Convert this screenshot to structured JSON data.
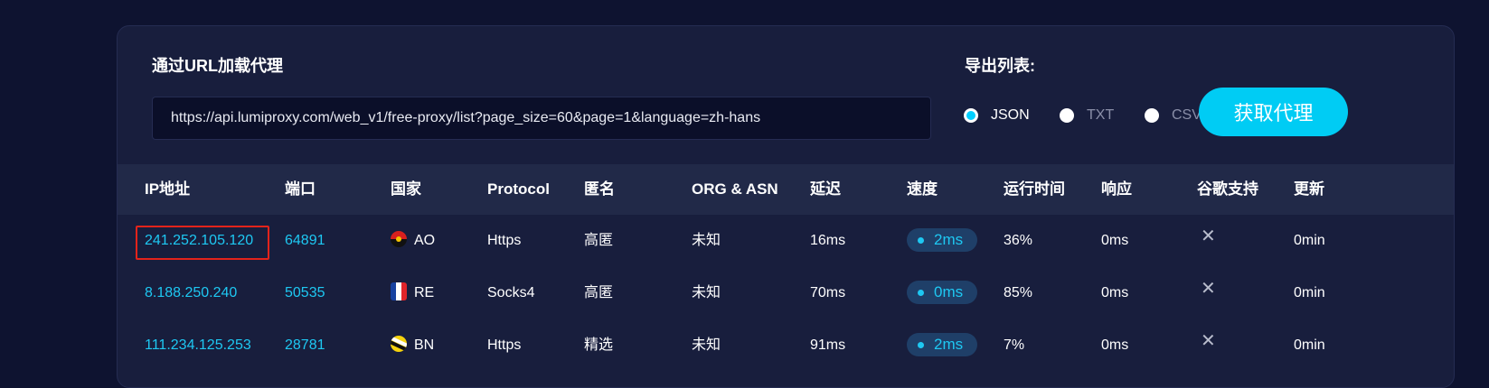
{
  "loader": {
    "title": "通过URL加载代理",
    "url_value": "https://api.lumiproxy.com/web_v1/free-proxy/list?page_size=60&page=1&language=zh-hans"
  },
  "export": {
    "title": "导出列表:",
    "options": [
      {
        "label": "JSON",
        "selected": true
      },
      {
        "label": "TXT",
        "selected": false
      },
      {
        "label": "CSV",
        "selected": false
      }
    ],
    "fetch_button": "获取代理"
  },
  "table": {
    "headers": [
      "IP地址",
      "端口",
      "国家",
      "Protocol",
      "匿名",
      "ORG & ASN",
      "延迟",
      "速度",
      "运行时间",
      "响应",
      "谷歌支持",
      "更新"
    ],
    "rows": [
      {
        "ip": "241.252.105.120",
        "port": "64891",
        "country": "AO",
        "flag": "angola-flag-icon",
        "protocol": "Https",
        "anonymity": "高匿",
        "org": "未知",
        "latency": "16ms",
        "speed": "2ms",
        "uptime": "36%",
        "response": "0ms",
        "google": "close-icon",
        "updated": "0min"
      },
      {
        "ip": "8.188.250.240",
        "port": "50535",
        "country": "RE",
        "flag": "france-flag-icon",
        "protocol": "Socks4",
        "anonymity": "高匿",
        "org": "未知",
        "latency": "70ms",
        "speed": "0ms",
        "uptime": "85%",
        "response": "0ms",
        "google": "close-icon",
        "updated": "0min"
      },
      {
        "ip": "111.234.125.253",
        "port": "28781",
        "country": "BN",
        "flag": "brunei-flag-icon",
        "protocol": "Https",
        "anonymity": "精选",
        "org": "未知",
        "latency": "91ms",
        "speed": "2ms",
        "uptime": "7%",
        "response": "0ms",
        "google": "close-icon",
        "updated": "0min"
      }
    ]
  },
  "colors": {
    "page_bg": "#0e1330",
    "card_bg": "#181e3d",
    "header_row_bg": "#212948",
    "accent": "#00ccf4",
    "link": "#1ec8f2",
    "highlight_border": "#e3231b"
  }
}
